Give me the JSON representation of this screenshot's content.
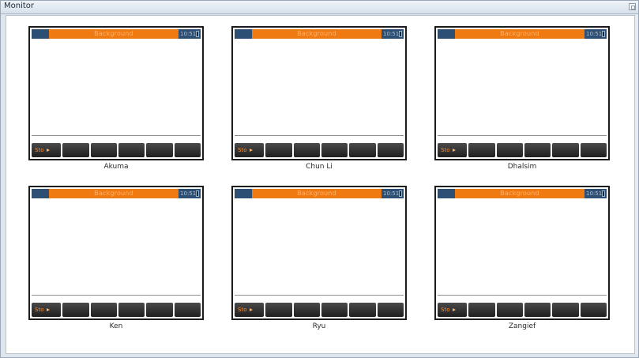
{
  "window": {
    "title": "Monitor"
  },
  "devices": [
    {
      "name": "Akuma",
      "status": "Background",
      "time": "10:51",
      "first_key": "Sto"
    },
    {
      "name": "Chun Li",
      "status": "Background",
      "time": "10:51",
      "first_key": "Sto"
    },
    {
      "name": "Dhalsim",
      "status": "Background",
      "time": "10:51",
      "first_key": "Sto"
    },
    {
      "name": "Ken",
      "status": "Background",
      "time": "10:51",
      "first_key": "Sto"
    },
    {
      "name": "Ryu",
      "status": "Background",
      "time": "10:51",
      "first_key": "Sto"
    },
    {
      "name": "Zangief",
      "status": "Background",
      "time": "10:51",
      "first_key": "Sto"
    }
  ],
  "colors": {
    "status_bar": "#f07a12",
    "status_side": "#2e4f74",
    "keys": "#262626",
    "key_label": "#ff8b2c"
  }
}
